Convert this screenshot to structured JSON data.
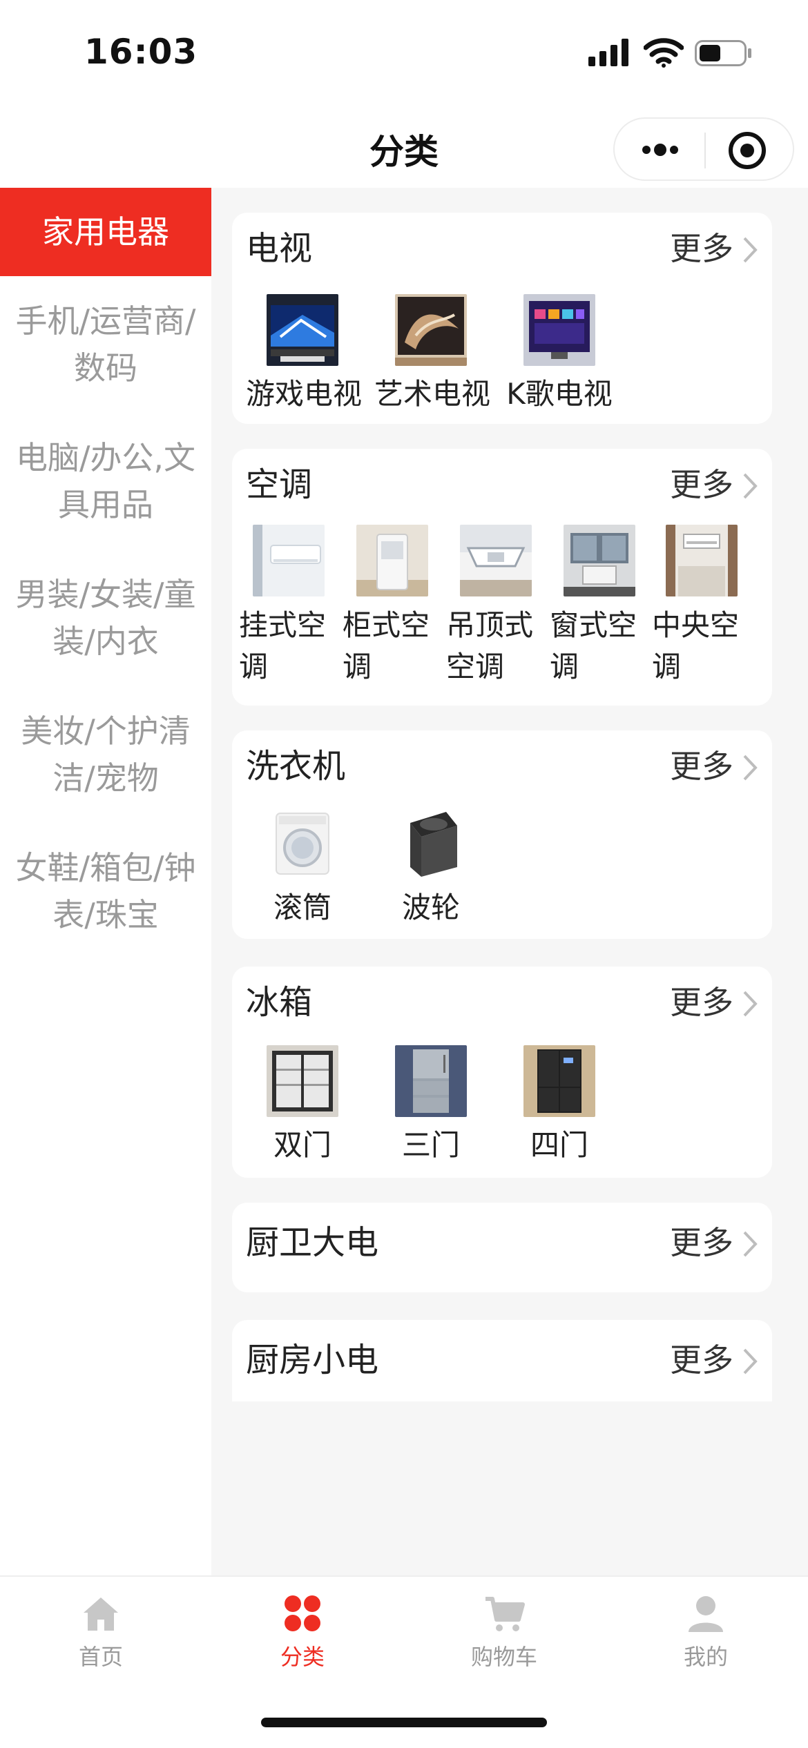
{
  "status_bar": {
    "time": "16:03"
  },
  "nav": {
    "title": "分类"
  },
  "sidebar": {
    "items": [
      {
        "label": "家用电器"
      },
      {
        "label": "手机/运营商/数码"
      },
      {
        "label": "电脑/办公,文具用品"
      },
      {
        "label": "男装/女装/童装/内衣"
      },
      {
        "label": "美妆/个护清洁/宠物"
      },
      {
        "label": "女鞋/箱包/钟表/珠宝"
      }
    ]
  },
  "content": {
    "more_label": "更多",
    "sections": [
      {
        "title": "电视",
        "items": [
          {
            "label": "游戏电视"
          },
          {
            "label": "艺术电视"
          },
          {
            "label": "K歌电视"
          }
        ]
      },
      {
        "title": "空调",
        "items": [
          {
            "label": "挂式空调"
          },
          {
            "label": "柜式空调"
          },
          {
            "label": "吊顶式空调"
          },
          {
            "label": "窗式空调"
          },
          {
            "label": "中央空调"
          }
        ]
      },
      {
        "title": "洗衣机",
        "items": [
          {
            "label": "滚筒"
          },
          {
            "label": "波轮"
          }
        ]
      },
      {
        "title": "冰箱",
        "items": [
          {
            "label": "双门"
          },
          {
            "label": "三门"
          },
          {
            "label": "四门"
          }
        ]
      },
      {
        "title": "厨卫大电",
        "items": []
      },
      {
        "title": "厨房小电",
        "items": []
      }
    ]
  },
  "tab_bar": {
    "active_color": "#ee2d22",
    "tabs": [
      {
        "label": "首页",
        "icon": "home-icon"
      },
      {
        "label": "分类",
        "icon": "category-icon"
      },
      {
        "label": "购物车",
        "icon": "cart-icon"
      },
      {
        "label": "我的",
        "icon": "user-icon"
      }
    ]
  }
}
